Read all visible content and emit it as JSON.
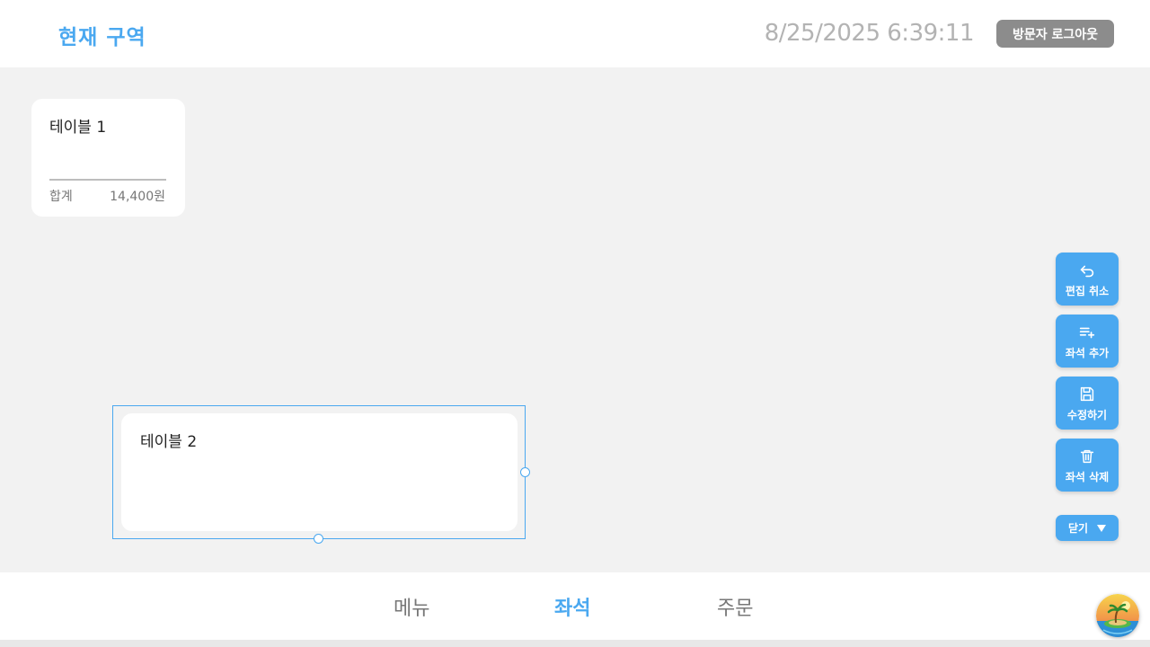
{
  "header": {
    "zone_title": "현재 구역",
    "datetime": "8/25/2025 6:39:11",
    "logout_label": "방문자 로그아웃"
  },
  "tables": [
    {
      "name": "테이블 1",
      "total_label": "합계",
      "total_value": "14,400원"
    },
    {
      "name": "테이블 2"
    }
  ],
  "side_actions": [
    {
      "label": "편집 취소",
      "icon": "undo-icon"
    },
    {
      "label": "좌석 추가",
      "icon": "list-add-icon"
    },
    {
      "label": "수정하기",
      "icon": "save-icon"
    },
    {
      "label": "좌석 삭제",
      "icon": "trash-icon"
    }
  ],
  "close_button": {
    "label": "닫기",
    "icon": "triangle-down-icon"
  },
  "bottom_nav": {
    "tabs": [
      {
        "label": "메뉴",
        "active": false
      },
      {
        "label": "좌석",
        "active": true
      },
      {
        "label": "주문",
        "active": false
      }
    ]
  },
  "colors": {
    "accent": "#4aa8f0",
    "background": "#f2f2f2",
    "logout_bg": "#8c8c8c"
  }
}
